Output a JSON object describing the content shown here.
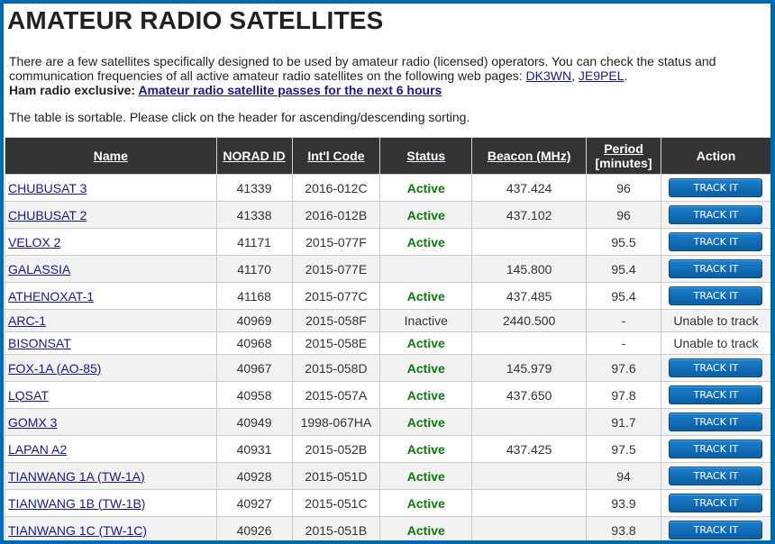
{
  "page": {
    "title": "AMATEUR RADIO SATELLITES",
    "intro_text_1": "There are a few satellites specifically designed to be used by amateur radio (licensed) operators. You can check the status and communication frequencies of all active amateur radio satellites on the following web pages: ",
    "link_dk3wn": "DK3WN",
    "separator": ", ",
    "link_je9pel": "JE9PEL",
    "intro_end": ".",
    "exclusive_label": "Ham radio exclusive: ",
    "exclusive_link": "Amateur radio satellite passes for the next 6 hours",
    "sort_note": "The table is sortable. Please click on the header for ascending/descending sorting."
  },
  "table": {
    "headers": {
      "name": "Name",
      "norad": "NORAD ID",
      "intl": "Int'l Code",
      "status": "Status",
      "beacon": "Beacon (MHz)",
      "period_line1": "Period",
      "period_line2": "[minutes]",
      "action": "Action"
    },
    "track_label": "TRACK IT",
    "unable_label": "Unable to track",
    "colors": {
      "header_bg": "#333333",
      "active": "#0a7a0a",
      "button": "#0a5da3",
      "frame": "#0069b4"
    },
    "rows": [
      {
        "name": "CHUBUSAT 3",
        "norad": "41339",
        "intl": "2016-012C",
        "status": "Active",
        "beacon": "437.424",
        "period": "96",
        "trackable": true
      },
      {
        "name": "CHUBUSAT 2",
        "norad": "41338",
        "intl": "2016-012B",
        "status": "Active",
        "beacon": "437.102",
        "period": "96",
        "trackable": true
      },
      {
        "name": "VELOX 2",
        "norad": "41171",
        "intl": "2015-077F",
        "status": "Active",
        "beacon": "",
        "period": "95.5",
        "trackable": true
      },
      {
        "name": "GALASSIA",
        "norad": "41170",
        "intl": "2015-077E",
        "status": "",
        "beacon": "145.800",
        "period": "95.4",
        "trackable": true
      },
      {
        "name": "ATHENOXAT-1",
        "norad": "41168",
        "intl": "2015-077C",
        "status": "Active",
        "beacon": "437.485",
        "period": "95.4",
        "trackable": true
      },
      {
        "name": "ARC-1",
        "norad": "40969",
        "intl": "2015-058F",
        "status": "Inactive",
        "beacon": "2440.500",
        "period": "-",
        "trackable": false
      },
      {
        "name": "BISONSAT",
        "norad": "40968",
        "intl": "2015-058E",
        "status": "Active",
        "beacon": "",
        "period": "-",
        "trackable": false
      },
      {
        "name": "FOX-1A (AO-85)",
        "norad": "40967",
        "intl": "2015-058D",
        "status": "Active",
        "beacon": "145.979",
        "period": "97.6",
        "trackable": true
      },
      {
        "name": "LQSAT",
        "norad": "40958",
        "intl": "2015-057A",
        "status": "Active",
        "beacon": "437.650",
        "period": "97.8",
        "trackable": true
      },
      {
        "name": "GOMX 3",
        "norad": "40949",
        "intl": "1998-067HA",
        "status": "Active",
        "beacon": "",
        "period": "91.7",
        "trackable": true
      },
      {
        "name": "LAPAN A2",
        "norad": "40931",
        "intl": "2015-052B",
        "status": "Active",
        "beacon": "437.425",
        "period": "97.5",
        "trackable": true
      },
      {
        "name": "TIANWANG 1A (TW-1A)",
        "norad": "40928",
        "intl": "2015-051D",
        "status": "Active",
        "beacon": "",
        "period": "94",
        "trackable": true
      },
      {
        "name": "TIANWANG 1B (TW-1B)",
        "norad": "40927",
        "intl": "2015-051C",
        "status": "Active",
        "beacon": "",
        "period": "93.9",
        "trackable": true
      },
      {
        "name": "TIANWANG 1C (TW-1C)",
        "norad": "40926",
        "intl": "2015-051B",
        "status": "Active",
        "beacon": "",
        "period": "93.8",
        "trackable": true
      }
    ]
  }
}
